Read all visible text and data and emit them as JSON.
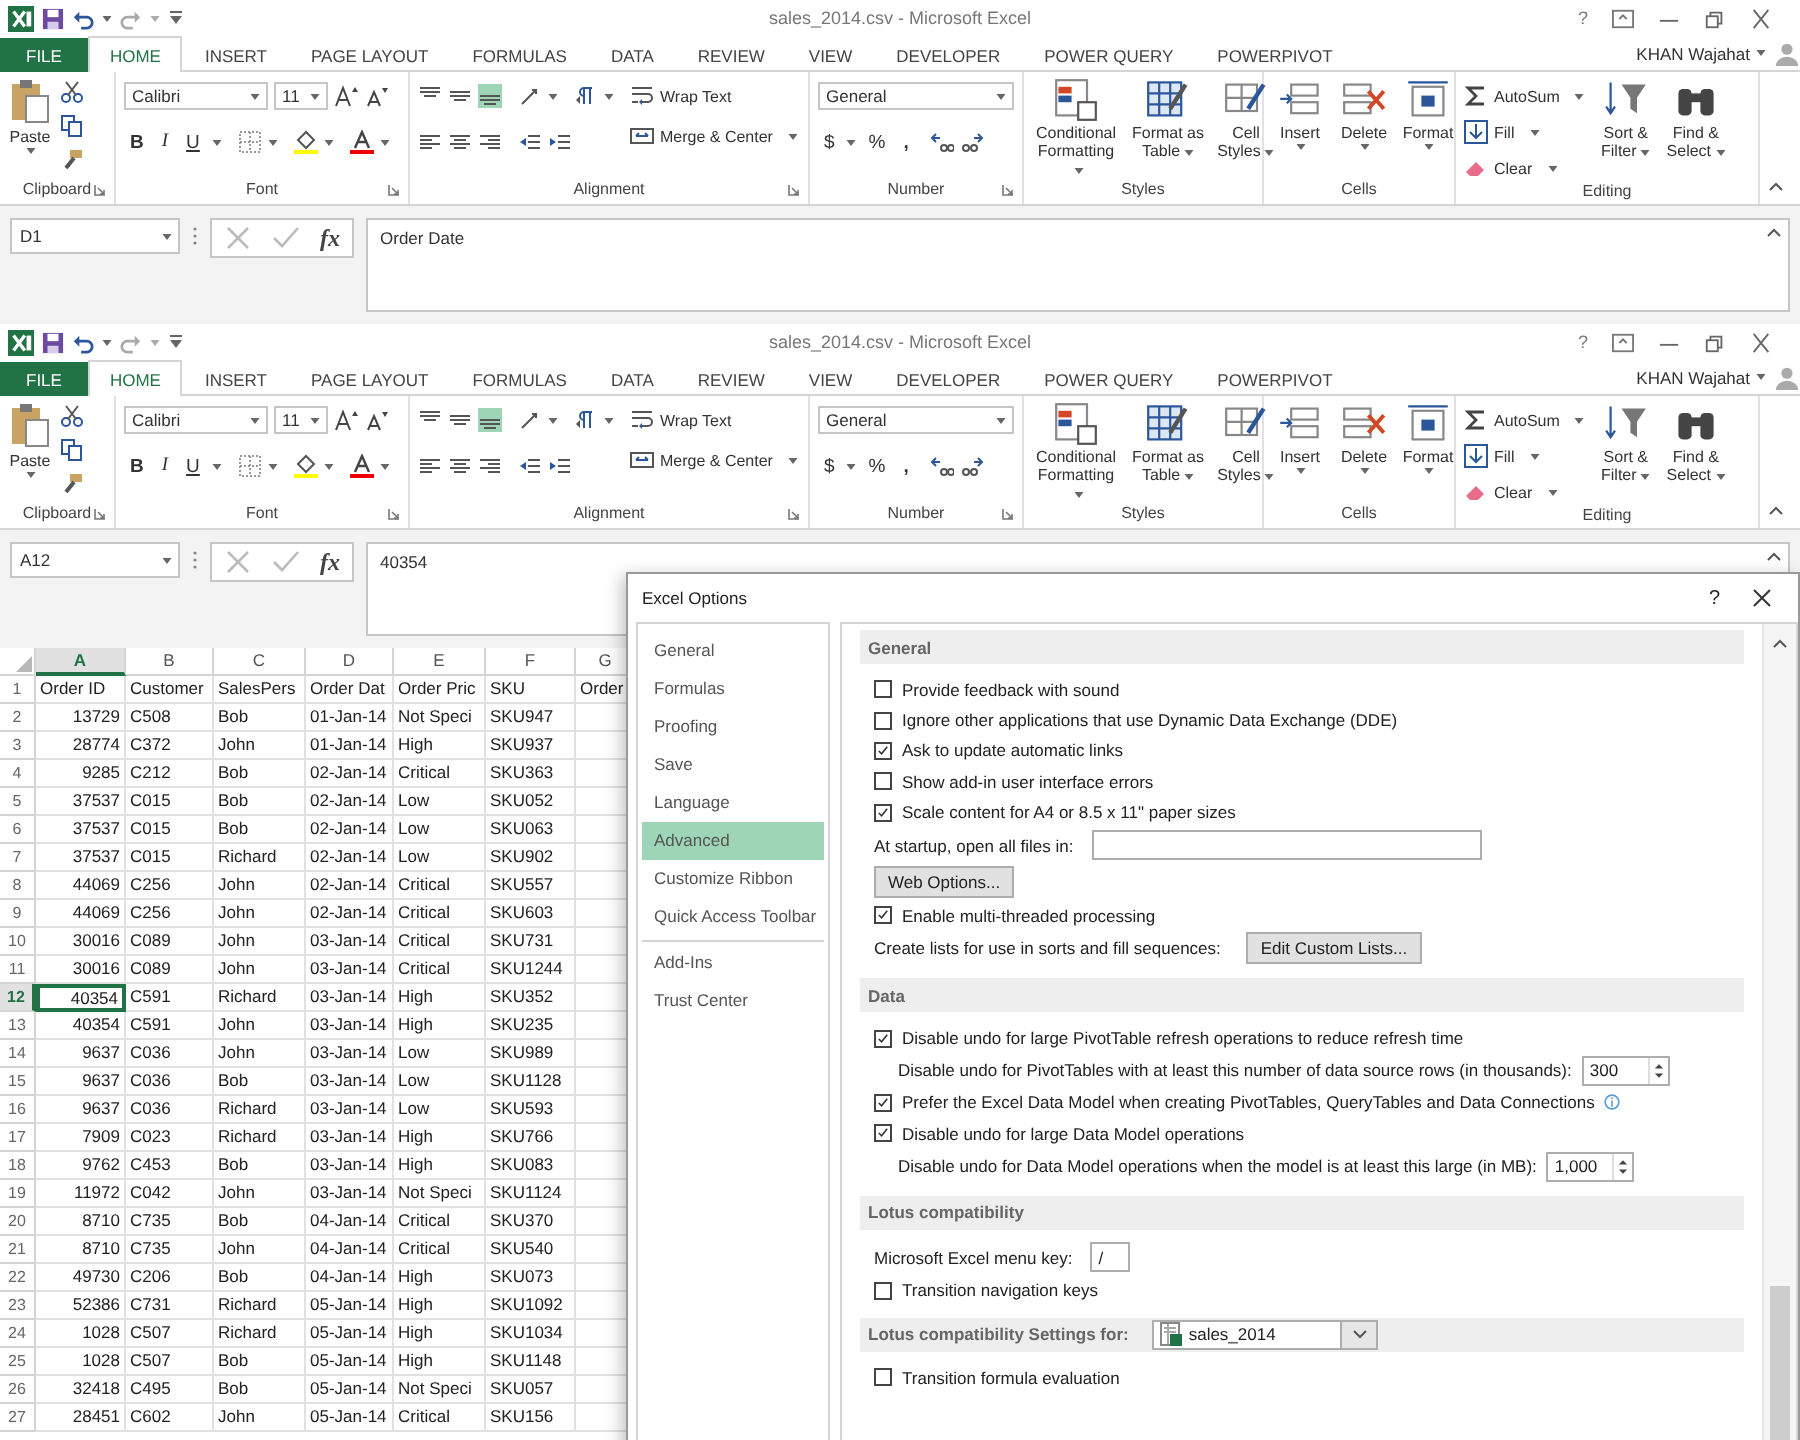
{
  "windows": [
    {
      "title": "sales_2014.csv - Microsoft Excel",
      "help": "?",
      "account": "KHAN Wajahat",
      "tabs": [
        {
          "label": "FILE",
          "kind": "file",
          "selected": false
        },
        {
          "label": "HOME",
          "kind": "tab",
          "selected": true
        },
        {
          "label": "INSERT",
          "kind": "tab",
          "selected": false
        },
        {
          "label": "PAGE LAYOUT",
          "kind": "tab",
          "selected": false
        },
        {
          "label": "FORMULAS",
          "kind": "tab",
          "selected": false
        },
        {
          "label": "DATA",
          "kind": "tab",
          "selected": false
        },
        {
          "label": "REVIEW",
          "kind": "tab",
          "selected": false
        },
        {
          "label": "VIEW",
          "kind": "tab",
          "selected": false
        },
        {
          "label": "DEVELOPER",
          "kind": "tab",
          "selected": false
        },
        {
          "label": "POWER QUERY",
          "kind": "tab",
          "selected": false
        },
        {
          "label": "POWERPIVOT",
          "kind": "tab",
          "selected": false
        }
      ],
      "ribbon": [
        {
          "kind": "clipboard",
          "label": "Clipboard",
          "launcher": true,
          "paste": "Paste"
        },
        {
          "kind": "font",
          "label": "Font",
          "launcher": true,
          "font": "Calibri",
          "size": "11",
          "bold": "B",
          "italic": "I",
          "underline": "U"
        },
        {
          "kind": "alignment",
          "label": "Alignment",
          "launcher": true,
          "bottom_align_selected": true,
          "wrap": "Wrap Text",
          "merge": "Merge & Center"
        },
        {
          "kind": "number",
          "label": "Number",
          "launcher": true,
          "format": "General",
          "currency": "$",
          "percent": "%",
          "comma": ","
        },
        {
          "kind": "styles",
          "label": "Styles",
          "launcher": false,
          "buttons": [
            "Conditional Formatting",
            "Format as Table",
            "Cell Styles"
          ]
        },
        {
          "kind": "cells",
          "label": "Cells",
          "launcher": false,
          "buttons": [
            "Insert",
            "Delete",
            "Format"
          ]
        },
        {
          "kind": "editing",
          "label": "Editing",
          "launcher": false,
          "autosum": "AutoSum",
          "fill": "Fill",
          "clear": "Clear",
          "sort": "Sort & Filter",
          "find": "Find & Select"
        }
      ],
      "formula_bar": {
        "name_box": "D1",
        "fx": "fx",
        "value": "Order Date"
      }
    },
    {
      "title": "sales_2014.csv - Microsoft Excel",
      "help": "?",
      "account": "KHAN Wajahat",
      "tabs": [
        {
          "label": "FILE",
          "kind": "file",
          "selected": false
        },
        {
          "label": "HOME",
          "kind": "tab",
          "selected": true
        },
        {
          "label": "INSERT",
          "kind": "tab",
          "selected": false
        },
        {
          "label": "PAGE LAYOUT",
          "kind": "tab",
          "selected": false
        },
        {
          "label": "FORMULAS",
          "kind": "tab",
          "selected": false
        },
        {
          "label": "DATA",
          "kind": "tab",
          "selected": false
        },
        {
          "label": "REVIEW",
          "kind": "tab",
          "selected": false
        },
        {
          "label": "VIEW",
          "kind": "tab",
          "selected": false
        },
        {
          "label": "DEVELOPER",
          "kind": "tab",
          "selected": false
        },
        {
          "label": "POWER QUERY",
          "kind": "tab",
          "selected": false
        },
        {
          "label": "POWERPIVOT",
          "kind": "tab",
          "selected": false
        }
      ],
      "ribbon": [
        {
          "kind": "clipboard",
          "label": "Clipboard",
          "launcher": true,
          "paste": "Paste"
        },
        {
          "kind": "font",
          "label": "Font",
          "launcher": true,
          "font": "Calibri",
          "size": "11",
          "bold": "B",
          "italic": "I",
          "underline": "U"
        },
        {
          "kind": "alignment",
          "label": "Alignment",
          "launcher": true,
          "bottom_align_selected": true,
          "wrap": "Wrap Text",
          "merge": "Merge & Center"
        },
        {
          "kind": "number",
          "label": "Number",
          "launcher": true,
          "format": "General",
          "currency": "$",
          "percent": "%",
          "comma": ","
        },
        {
          "kind": "styles",
          "label": "Styles",
          "launcher": false,
          "buttons": [
            "Conditional Formatting",
            "Format as Table",
            "Cell Styles"
          ]
        },
        {
          "kind": "cells",
          "label": "Cells",
          "launcher": false,
          "buttons": [
            "Insert",
            "Delete",
            "Format"
          ]
        },
        {
          "kind": "editing",
          "label": "Editing",
          "launcher": false,
          "autosum": "AutoSum",
          "fill": "Fill",
          "clear": "Clear",
          "sort": "Sort & Filter",
          "find": "Find & Select"
        }
      ],
      "formula_bar": {
        "name_box": "A12",
        "fx": "fx",
        "value": "40354"
      }
    }
  ],
  "sheet": {
    "columns": [
      {
        "label": "A",
        "selected": true
      },
      {
        "label": "B",
        "selected": false
      },
      {
        "label": "C",
        "selected": false
      },
      {
        "label": "D",
        "selected": false
      },
      {
        "label": "E",
        "selected": false
      },
      {
        "label": "F",
        "selected": false
      },
      {
        "label": "G",
        "selected": false
      }
    ],
    "rows": [
      {
        "number": "1",
        "kind": "header",
        "selected": false,
        "cells": [
          "Order ID",
          "Customer",
          "SalesPers",
          "Order Dat",
          "Order Pric",
          "SKU",
          "Order"
        ]
      },
      {
        "number": "2",
        "kind": "data",
        "selected": false,
        "cells": [
          "13729",
          "C508",
          "Bob",
          "01-Jan-14",
          "Not Speci",
          "SKU947"
        ]
      },
      {
        "number": "3",
        "kind": "data",
        "selected": false,
        "cells": [
          "28774",
          "C372",
          "John",
          "01-Jan-14",
          "High",
          "SKU937"
        ]
      },
      {
        "number": "4",
        "kind": "data",
        "selected": false,
        "cells": [
          "9285",
          "C212",
          "Bob",
          "02-Jan-14",
          "Critical",
          "SKU363"
        ]
      },
      {
        "number": "5",
        "kind": "data",
        "selected": false,
        "cells": [
          "37537",
          "C015",
          "Bob",
          "02-Jan-14",
          "Low",
          "SKU052"
        ]
      },
      {
        "number": "6",
        "kind": "data",
        "selected": false,
        "cells": [
          "37537",
          "C015",
          "Bob",
          "02-Jan-14",
          "Low",
          "SKU063"
        ]
      },
      {
        "number": "7",
        "kind": "data",
        "selected": false,
        "cells": [
          "37537",
          "C015",
          "Richard",
          "02-Jan-14",
          "Low",
          "SKU902"
        ]
      },
      {
        "number": "8",
        "kind": "data",
        "selected": false,
        "cells": [
          "44069",
          "C256",
          "John",
          "02-Jan-14",
          "Critical",
          "SKU557"
        ]
      },
      {
        "number": "9",
        "kind": "data",
        "selected": false,
        "cells": [
          "44069",
          "C256",
          "John",
          "02-Jan-14",
          "Critical",
          "SKU603"
        ]
      },
      {
        "number": "10",
        "kind": "data",
        "selected": false,
        "cells": [
          "30016",
          "C089",
          "John",
          "03-Jan-14",
          "Critical",
          "SKU731"
        ]
      },
      {
        "number": "11",
        "kind": "data",
        "selected": false,
        "cells": [
          "30016",
          "C089",
          "John",
          "03-Jan-14",
          "Critical",
          "SKU1244"
        ]
      },
      {
        "number": "12",
        "kind": "data",
        "selected": true,
        "cells": [
          "40354",
          "C591",
          "Richard",
          "03-Jan-14",
          "High",
          "SKU352"
        ]
      },
      {
        "number": "13",
        "kind": "data",
        "selected": false,
        "cells": [
          "40354",
          "C591",
          "John",
          "03-Jan-14",
          "High",
          "SKU235"
        ]
      },
      {
        "number": "14",
        "kind": "data",
        "selected": false,
        "cells": [
          "9637",
          "C036",
          "John",
          "03-Jan-14",
          "Low",
          "SKU989"
        ]
      },
      {
        "number": "15",
        "kind": "data",
        "selected": false,
        "cells": [
          "9637",
          "C036",
          "Bob",
          "03-Jan-14",
          "Low",
          "SKU1128"
        ]
      },
      {
        "number": "16",
        "kind": "data",
        "selected": false,
        "cells": [
          "9637",
          "C036",
          "Richard",
          "03-Jan-14",
          "Low",
          "SKU593"
        ]
      },
      {
        "number": "17",
        "kind": "data",
        "selected": false,
        "cells": [
          "7909",
          "C023",
          "Richard",
          "03-Jan-14",
          "High",
          "SKU766"
        ]
      },
      {
        "number": "18",
        "kind": "data",
        "selected": false,
        "cells": [
          "9762",
          "C453",
          "Bob",
          "03-Jan-14",
          "High",
          "SKU083"
        ]
      },
      {
        "number": "19",
        "kind": "data",
        "selected": false,
        "cells": [
          "11972",
          "C042",
          "John",
          "03-Jan-14",
          "Not Speci",
          "SKU1124"
        ]
      },
      {
        "number": "20",
        "kind": "data",
        "selected": false,
        "cells": [
          "8710",
          "C735",
          "Bob",
          "04-Jan-14",
          "Critical",
          "SKU370"
        ]
      },
      {
        "number": "21",
        "kind": "data",
        "selected": false,
        "cells": [
          "8710",
          "C735",
          "John",
          "04-Jan-14",
          "Critical",
          "SKU540"
        ]
      },
      {
        "number": "22",
        "kind": "data",
        "selected": false,
        "cells": [
          "49730",
          "C206",
          "Bob",
          "04-Jan-14",
          "High",
          "SKU073"
        ]
      },
      {
        "number": "23",
        "kind": "data",
        "selected": false,
        "cells": [
          "52386",
          "C731",
          "Richard",
          "05-Jan-14",
          "High",
          "SKU1092"
        ]
      },
      {
        "number": "24",
        "kind": "data",
        "selected": false,
        "cells": [
          "1028",
          "C507",
          "Richard",
          "05-Jan-14",
          "High",
          "SKU1034"
        ]
      },
      {
        "number": "25",
        "kind": "data",
        "selected": false,
        "cells": [
          "1028",
          "C507",
          "Bob",
          "05-Jan-14",
          "High",
          "SKU1148"
        ]
      },
      {
        "number": "26",
        "kind": "data",
        "selected": false,
        "cells": [
          "32418",
          "C495",
          "Bob",
          "05-Jan-14",
          "Not Speci",
          "SKU057"
        ]
      },
      {
        "number": "27",
        "kind": "data",
        "selected": false,
        "cells": [
          "28451",
          "C602",
          "John",
          "05-Jan-14",
          "Critical",
          "SKU156"
        ]
      }
    ]
  },
  "dialog": {
    "title": "Excel Options",
    "help": "?",
    "nav": [
      {
        "items": [
          {
            "label": "General",
            "selected": false
          },
          {
            "label": "Formulas",
            "selected": false
          },
          {
            "label": "Proofing",
            "selected": false
          },
          {
            "label": "Save",
            "selected": false
          },
          {
            "label": "Language",
            "selected": false
          },
          {
            "label": "Advanced",
            "selected": true
          },
          {
            "label": "Customize Ribbon",
            "selected": false
          },
          {
            "label": "Quick Access Toolbar",
            "selected": false
          }
        ]
      },
      {
        "items": [
          {
            "label": "Add-Ins",
            "selected": false
          },
          {
            "label": "Trust Center",
            "selected": false
          }
        ]
      }
    ],
    "sections": [
      {
        "title": "General",
        "items": [
          {
            "kind": "checkbox",
            "label": "Provide feedback with sound",
            "checked": false
          },
          {
            "kind": "checkbox",
            "label": "Ignore other applications that use Dynamic Data Exchange (DDE)",
            "checked": false
          },
          {
            "kind": "checkbox",
            "label": "Ask to update automatic links",
            "checked": true
          },
          {
            "kind": "checkbox",
            "label": "Show add-in user interface errors",
            "checked": false
          },
          {
            "kind": "checkbox",
            "label": "Scale content for A4 or 8.5 x 11\" paper sizes",
            "checked": true
          },
          {
            "kind": "text_field",
            "label": "At startup, open all files in:"
          },
          {
            "kind": "button",
            "label": "Web Options..."
          },
          {
            "kind": "checkbox",
            "label": "Enable multi-threaded processing",
            "checked": true
          },
          {
            "kind": "button_row",
            "label": "Create lists for use in sorts and fill sequences:",
            "button": "Edit Custom Lists..."
          }
        ]
      },
      {
        "title": "Data",
        "items": [
          {
            "kind": "checkbox",
            "label": "Disable undo for large PivotTable refresh operations to reduce refresh time",
            "checked": true
          },
          {
            "kind": "spinner",
            "label": "Disable undo for PivotTables with at least this number of data source rows (in thousands):",
            "value": "300"
          },
          {
            "kind": "checkbox",
            "label": "Prefer the Excel Data Model when creating PivotTables, QueryTables and Data Connections",
            "checked": true,
            "info": true
          },
          {
            "kind": "checkbox",
            "label": "Disable undo for large Data Model operations",
            "checked": true
          },
          {
            "kind": "spinner",
            "label": "Disable undo for Data Model operations when the model is at least this large (in MB):",
            "value": "1,000"
          }
        ]
      },
      {
        "title": "Lotus compatibility",
        "items": [
          {
            "kind": "key_field",
            "label": "Microsoft Excel menu key:",
            "value": "/"
          },
          {
            "kind": "checkbox",
            "label": "Transition navigation keys",
            "checked": false
          }
        ]
      },
      {
        "title": "Lotus compatibility Settings for:",
        "dropdown": "sales_2014",
        "items": [
          {
            "kind": "checkbox",
            "label": "Transition formula evaluation",
            "checked": false
          }
        ]
      }
    ]
  }
}
